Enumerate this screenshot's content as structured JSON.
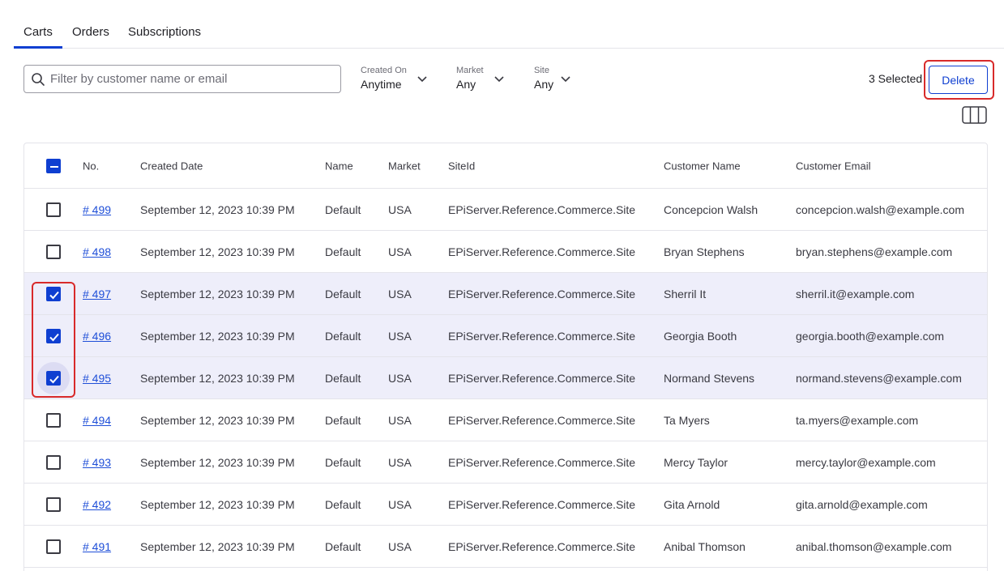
{
  "tabs": [
    {
      "label": "Carts",
      "active": true
    },
    {
      "label": "Orders",
      "active": false
    },
    {
      "label": "Subscriptions",
      "active": false
    }
  ],
  "filters": {
    "search_placeholder": "Filter by customer name or email",
    "created_on": {
      "label": "Created On",
      "value": "Anytime"
    },
    "market": {
      "label": "Market",
      "value": "Any"
    },
    "site": {
      "label": "Site",
      "value": "Any"
    }
  },
  "selection": {
    "count_text": "3 Selected",
    "delete_label": "Delete"
  },
  "table": {
    "columns": [
      "No.",
      "Created Date",
      "Name",
      "Market",
      "SiteId",
      "Customer Name",
      "Customer Email"
    ],
    "rows": [
      {
        "no": "# 499",
        "created": "September 12, 2023 10:39 PM",
        "name": "Default",
        "market": "USA",
        "site": "EPiServer.Reference.Commerce.Site",
        "customer": "Concepcion Walsh",
        "email": "concepcion.walsh@example.com",
        "checked": false
      },
      {
        "no": "# 498",
        "created": "September 12, 2023 10:39 PM",
        "name": "Default",
        "market": "USA",
        "site": "EPiServer.Reference.Commerce.Site",
        "customer": "Bryan Stephens",
        "email": "bryan.stephens@example.com",
        "checked": false
      },
      {
        "no": "# 497",
        "created": "September 12, 2023 10:39 PM",
        "name": "Default",
        "market": "USA",
        "site": "EPiServer.Reference.Commerce.Site",
        "customer": "Sherril It",
        "email": "sherril.it@example.com",
        "checked": true
      },
      {
        "no": "# 496",
        "created": "September 12, 2023 10:39 PM",
        "name": "Default",
        "market": "USA",
        "site": "EPiServer.Reference.Commerce.Site",
        "customer": "Georgia Booth",
        "email": "georgia.booth@example.com",
        "checked": true
      },
      {
        "no": "# 495",
        "created": "September 12, 2023 10:39 PM",
        "name": "Default",
        "market": "USA",
        "site": "EPiServer.Reference.Commerce.Site",
        "customer": "Normand Stevens",
        "email": "normand.stevens@example.com",
        "checked": true
      },
      {
        "no": "# 494",
        "created": "September 12, 2023 10:39 PM",
        "name": "Default",
        "market": "USA",
        "site": "EPiServer.Reference.Commerce.Site",
        "customer": "Ta Myers",
        "email": "ta.myers@example.com",
        "checked": false
      },
      {
        "no": "# 493",
        "created": "September 12, 2023 10:39 PM",
        "name": "Default",
        "market": "USA",
        "site": "EPiServer.Reference.Commerce.Site",
        "customer": "Mercy Taylor",
        "email": "mercy.taylor@example.com",
        "checked": false
      },
      {
        "no": "# 492",
        "created": "September 12, 2023 10:39 PM",
        "name": "Default",
        "market": "USA",
        "site": "EPiServer.Reference.Commerce.Site",
        "customer": "Gita Arnold",
        "email": "gita.arnold@example.com",
        "checked": false
      },
      {
        "no": "# 491",
        "created": "September 12, 2023 10:39 PM",
        "name": "Default",
        "market": "USA",
        "site": "EPiServer.Reference.Commerce.Site",
        "customer": "Anibal Thomson",
        "email": "anibal.thomson@example.com",
        "checked": false
      }
    ]
  },
  "icons": {
    "search": "search-icon",
    "chevron": "chevron-down-icon",
    "columns": "columns-icon",
    "check": "checkmark-icon"
  },
  "colors": {
    "accent": "#0f3fd1",
    "highlight": "#d82a2a",
    "selected_row": "#eeeefa"
  }
}
